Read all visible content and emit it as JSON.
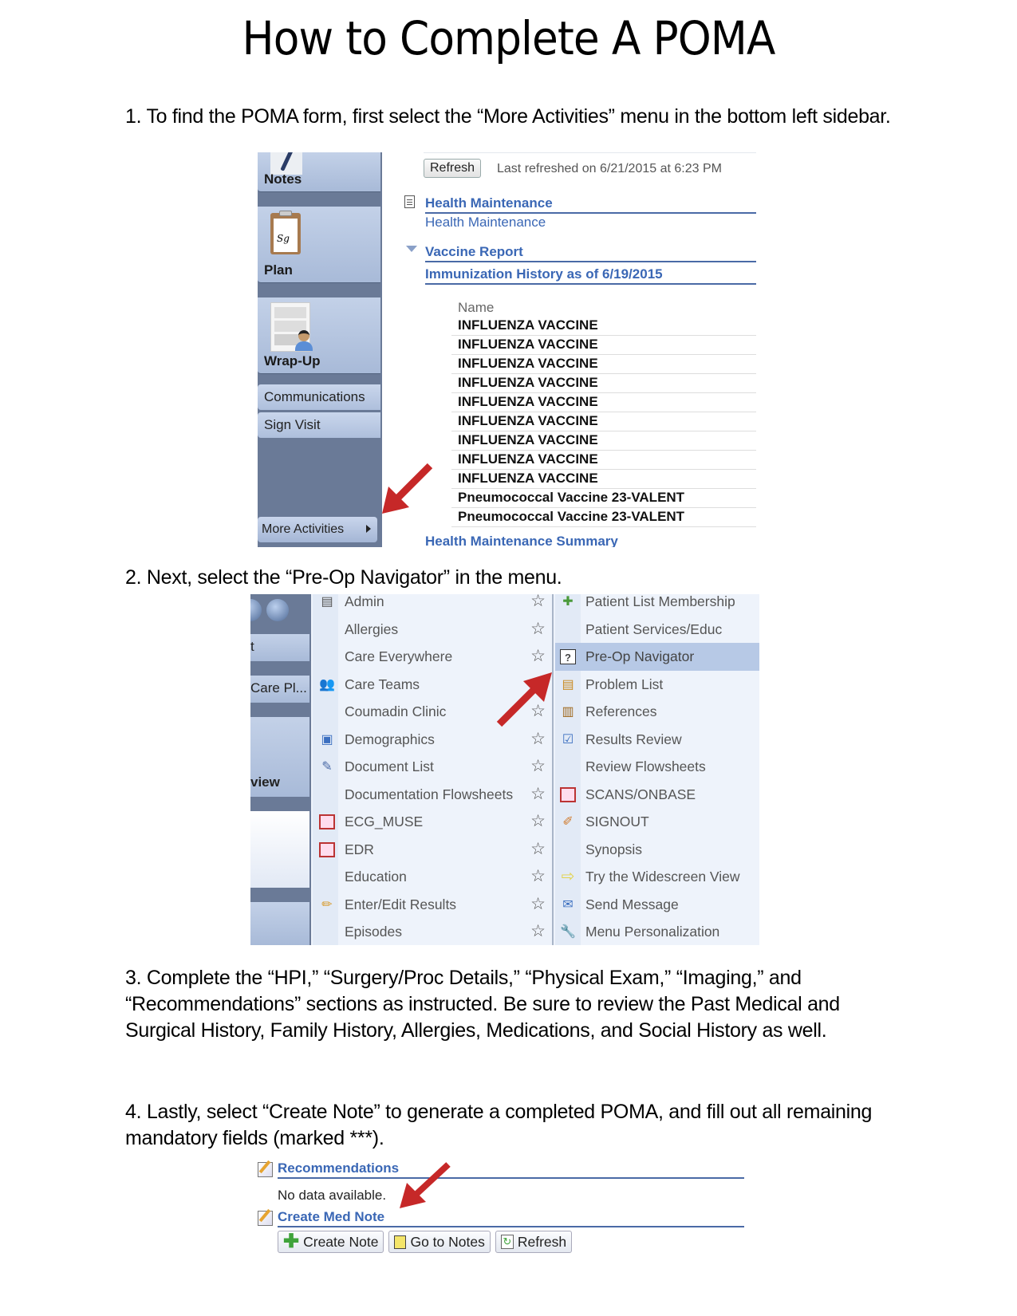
{
  "title": "How to Complete A POMA",
  "steps": {
    "s1": "1. To find the POMA form, first select the “More Activities” menu in the bottom left sidebar.",
    "s2": "2. Next, select the “Pre-Op Navigator” in the menu.",
    "s3": "3. Complete the “HPI,” “Surgery/Proc Details,” “Physical Exam,” “Imaging,” and “Recommendations” sections as instructed. Be sure to review the Past Medical and Surgical History, Family History, Allergies, Medications, and Social History as well.",
    "s4": "4. Lastly, select “Create Note” to generate a completed POMA, and fill out all remaining mandatory fields (marked ***)."
  },
  "screenshot1": {
    "sidebar": {
      "tiles": [
        {
          "label": "Notes",
          "icon": "pen-icon"
        },
        {
          "label": "Plan",
          "icon": "clipboard-icon"
        },
        {
          "label": "Wrap-Up",
          "icon": "wrap-up-icon"
        }
      ],
      "buttons": [
        "Communications",
        "Sign Visit"
      ],
      "more_activities": "More Activities"
    },
    "content": {
      "refresh_label": "Refresh",
      "last_refreshed": "Last refreshed on 6/21/2015 at 6:23 PM",
      "health_maintenance_header": "Health Maintenance",
      "health_maintenance_link": "Health Maintenance",
      "vaccine_report_header": "Vaccine Report",
      "immunization_header": "Immunization History as of 6/19/2015",
      "table_header": "Name",
      "immunizations": [
        "INFLUENZA VACCINE",
        "INFLUENZA VACCINE",
        "INFLUENZA VACCINE",
        "INFLUENZA VACCINE",
        "INFLUENZA VACCINE",
        "INFLUENZA VACCINE",
        "INFLUENZA VACCINE",
        "INFLUENZA VACCINE",
        "INFLUENZA VACCINE",
        "Pneumococcal Vaccine 23-VALENT",
        "Pneumococcal Vaccine 23-VALENT"
      ],
      "hm_summary": "Health Maintenance Summary"
    }
  },
  "screenshot2": {
    "left_tiles": [
      "t",
      "Care Pl...",
      "view"
    ],
    "menu_left": [
      {
        "label": "Admin",
        "icon": "admin-icon"
      },
      {
        "label": "Allergies",
        "icon": ""
      },
      {
        "label": "Care Everywhere",
        "icon": ""
      },
      {
        "label": "Care Teams",
        "icon": "care-teams-icon"
      },
      {
        "label": "Coumadin Clinic",
        "icon": ""
      },
      {
        "label": "Demographics",
        "icon": "demographics-icon"
      },
      {
        "label": "Document List",
        "icon": "document-list-icon"
      },
      {
        "label": "Documentation Flowsheets",
        "icon": ""
      },
      {
        "label": "ECG_MUSE",
        "icon": "image-viewer-icon"
      },
      {
        "label": "EDR",
        "icon": "image-viewer-icon"
      },
      {
        "label": "Education",
        "icon": ""
      },
      {
        "label": "Enter/Edit Results",
        "icon": "pencil-icon"
      },
      {
        "label": "Episodes",
        "icon": ""
      }
    ],
    "menu_right": [
      {
        "label": "Patient List Membership",
        "icon": "patient-list-icon"
      },
      {
        "label": "Patient Services/Educ",
        "icon": ""
      },
      {
        "label": "Pre-Op Navigator",
        "icon": "pre-op-icon",
        "highlighted": true
      },
      {
        "label": "Problem List",
        "icon": "problem-list-icon"
      },
      {
        "label": "References",
        "icon": "books-icon"
      },
      {
        "label": "Results Review",
        "icon": "results-review-icon"
      },
      {
        "label": "Review Flowsheets",
        "icon": ""
      },
      {
        "label": "SCANS/ONBASE",
        "icon": "image-viewer-icon"
      },
      {
        "label": "SIGNOUT",
        "icon": "signout-icon"
      },
      {
        "label": "Synopsis",
        "icon": ""
      },
      {
        "label": "Try the Widescreen View",
        "icon": "arrow-right-icon"
      },
      {
        "label": "Send Message",
        "icon": "send-message-icon"
      },
      {
        "label": "Menu Personalization",
        "icon": "wrench-icon"
      }
    ]
  },
  "screenshot3": {
    "recommendations_header": "Recommendations",
    "no_data": "No data available.",
    "create_med_note_header": "Create Med Note",
    "buttons": {
      "create_note": "Create Note",
      "go_to_notes": "Go to Notes",
      "refresh": "Refresh"
    }
  },
  "colors": {
    "link_blue": "#3a67b5",
    "sidebar_dark": "#6a7a97",
    "highlight": "#b7c9e6",
    "arrow_red": "#c62828"
  }
}
